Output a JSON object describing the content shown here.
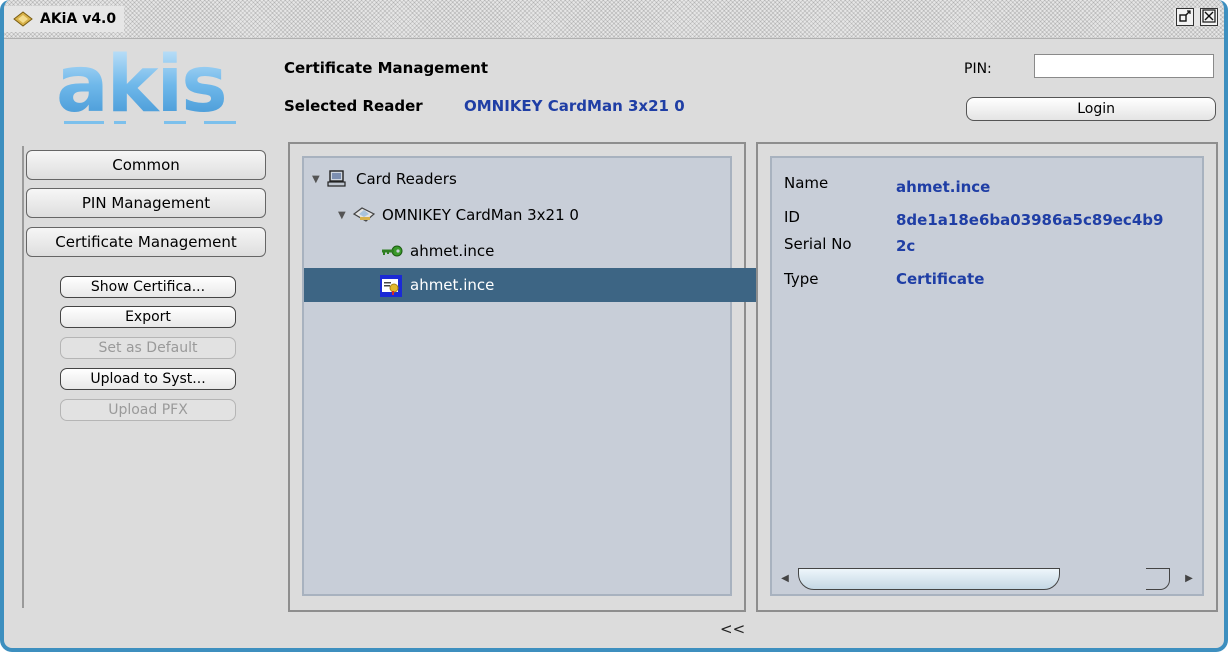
{
  "window": {
    "title": "AKiA v4.0",
    "restore_icon": "restore-icon",
    "close_icon": "close-icon"
  },
  "header": {
    "logo_text": "akis",
    "title": "Certificate Management",
    "reader_label": "Selected Reader",
    "reader_value": "OMNIKEY CardMan 3x21 0",
    "pin_label": "PIN:",
    "pin_value": "",
    "login_label": "Login"
  },
  "sidebar": {
    "nav": [
      {
        "label": "Common"
      },
      {
        "label": "PIN Management"
      },
      {
        "label": "Certificate Management"
      }
    ],
    "actions": [
      {
        "label": "Show Certifica...",
        "enabled": true
      },
      {
        "label": "Export",
        "enabled": true
      },
      {
        "label": "Set as Default",
        "enabled": false
      },
      {
        "label": "Upload to Syst...",
        "enabled": true
      },
      {
        "label": "Upload PFX",
        "enabled": false
      }
    ]
  },
  "tree": {
    "root": {
      "label": "Card Readers",
      "icon": "computer-icon"
    },
    "reader": {
      "label": "OMNIKEY CardMan 3x21 0",
      "icon": "smartcard-reader-icon"
    },
    "items": [
      {
        "label": "ahmet.ince",
        "icon": "key-icon",
        "selected": false
      },
      {
        "label": "ahmet.ince",
        "icon": "certificate-icon",
        "selected": true
      }
    ]
  },
  "details": {
    "fields": [
      {
        "label": "Name",
        "value": "ahmet.ince"
      },
      {
        "label": "ID",
        "value": "8de1a18e6ba03986a5c89ec4b9"
      },
      {
        "label": "Serial No",
        "value": "2c"
      },
      {
        "label": "Type",
        "value": "Certificate"
      }
    ]
  },
  "footer": {
    "collapse_label": "<<"
  },
  "colors": {
    "accent_blue": "#1f3ea5",
    "selection": "#3d6584",
    "panel": "#c8ced8",
    "window_border": "#3d8fbf"
  }
}
